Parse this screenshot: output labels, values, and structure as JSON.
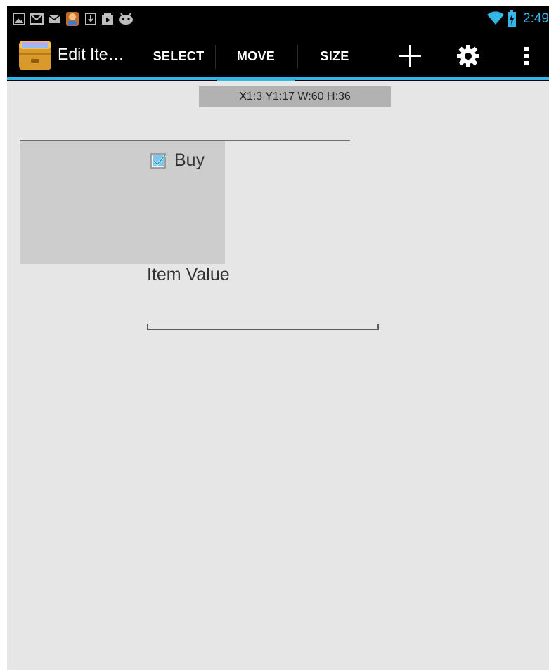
{
  "status_bar": {
    "time": "2:49",
    "notification_icons": [
      "gallery-icon",
      "gmail-icon",
      "email-icon",
      "game-icon",
      "download-icon",
      "play-store-icon",
      "android-icon"
    ],
    "system_icons": [
      "wifi-icon",
      "battery-icon"
    ]
  },
  "action_bar": {
    "app_title": "Edit Ite…",
    "tabs": [
      {
        "label": "SELECT",
        "selected": false
      },
      {
        "label": "MOVE",
        "selected": true
      },
      {
        "label": "SIZE",
        "selected": false
      }
    ],
    "actions": [
      "add-icon",
      "settings-icon",
      "overflow-menu-icon"
    ],
    "accent_color": "#33b5e5"
  },
  "editor": {
    "coordinates": "X1:3 Y1:17 W:60 H:36",
    "checkbox_label": "Buy",
    "checkbox_checked": true,
    "field_label": "Item Value",
    "field_value": ""
  }
}
